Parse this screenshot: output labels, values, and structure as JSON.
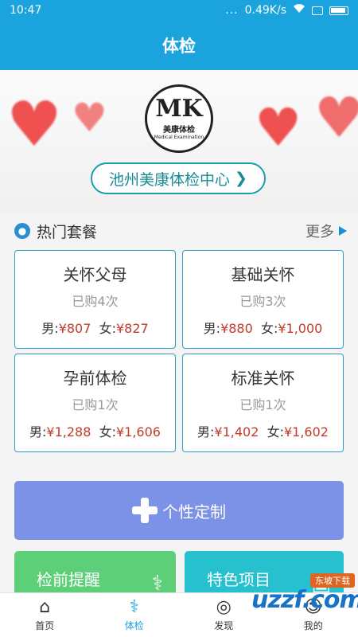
{
  "status": {
    "time": "10:47",
    "signal": "...",
    "speed": "0.49K/s"
  },
  "header": {
    "title": "体检"
  },
  "banner": {
    "logo_text": "MK",
    "logo_cn": "美康体检",
    "logo_en": "Medical Examination",
    "center_name": "池州美康体检中心",
    "center_arrow": "❯"
  },
  "section": {
    "title": "热门套餐",
    "more": "更多"
  },
  "packages": [
    {
      "name": "关怀父母",
      "count": "已购4次",
      "male_label": "男:",
      "male_price": "¥807",
      "female_label": "女:",
      "female_price": "¥827"
    },
    {
      "name": "基础关怀",
      "count": "已购3次",
      "male_label": "男:",
      "male_price": "¥880",
      "female_label": "女:",
      "female_price": "¥1,000"
    },
    {
      "name": "孕前体检",
      "count": "已购1次",
      "male_label": "男:",
      "male_price": "¥1,288",
      "female_label": "女:",
      "female_price": "¥1,606"
    },
    {
      "name": "标准关怀",
      "count": "已购1次",
      "male_label": "男:",
      "male_price": "¥1,402",
      "female_label": "女:",
      "female_price": "¥1,602"
    }
  ],
  "custom": {
    "label": "个性定制"
  },
  "tiles": [
    {
      "label": "检前提醒",
      "icon": "stethoscope-icon"
    },
    {
      "label": "特色项目",
      "icon": "monitor-icon"
    }
  ],
  "tabbar": [
    {
      "label": "首页",
      "icon": "home-icon",
      "active": false
    },
    {
      "label": "体检",
      "icon": "stethoscope-icon",
      "active": true
    },
    {
      "label": "发现",
      "icon": "discover-icon",
      "active": false
    },
    {
      "label": "我的",
      "icon": "user-icon",
      "active": false
    }
  ],
  "watermark": {
    "badge": "东坡下载",
    "text": "uzzf.com"
  },
  "colors": {
    "primary": "#1aa3dc",
    "price": "#c23a2a",
    "custom": "#7c92e6",
    "green": "#5ccf78",
    "teal": "#26c0cf"
  }
}
